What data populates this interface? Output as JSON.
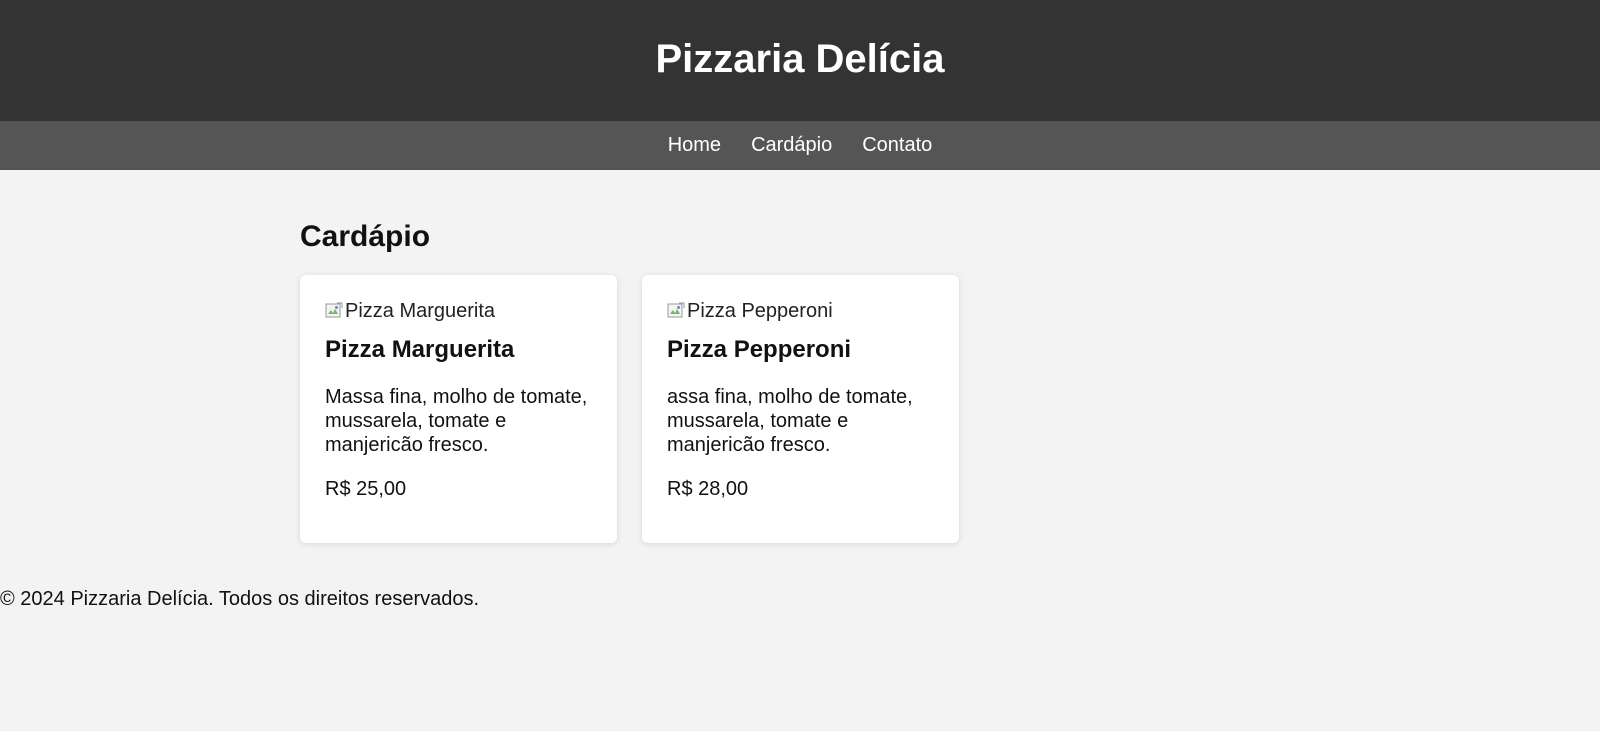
{
  "header": {
    "title": "Pizzaria Delícia"
  },
  "nav": {
    "items": [
      {
        "label": "Home"
      },
      {
        "label": "Cardápio"
      },
      {
        "label": "Contato"
      }
    ]
  },
  "menu": {
    "title": "Cardápio",
    "items": [
      {
        "image_alt": "Pizza Marguerita",
        "name": "Pizza Marguerita",
        "description": "Massa fina, molho de tomate, mussarela, tomate e manjericão fresco.",
        "price": "R$ 25,00"
      },
      {
        "image_alt": "Pizza Pepperoni",
        "name": "Pizza Pepperoni",
        "description": "assa fina, molho de tomate, mussarela, tomate e manjericão fresco.",
        "price": "R$ 28,00"
      }
    ]
  },
  "footer": {
    "text": "© 2024 Pizzaria Delícia. Todos os direitos reservados."
  },
  "colors": {
    "header_bg": "#333333",
    "nav_bg": "#555555",
    "page_bg": "#f3f3f3",
    "card_bg": "#ffffff"
  },
  "icons": {
    "broken_image": "broken-image-icon"
  }
}
